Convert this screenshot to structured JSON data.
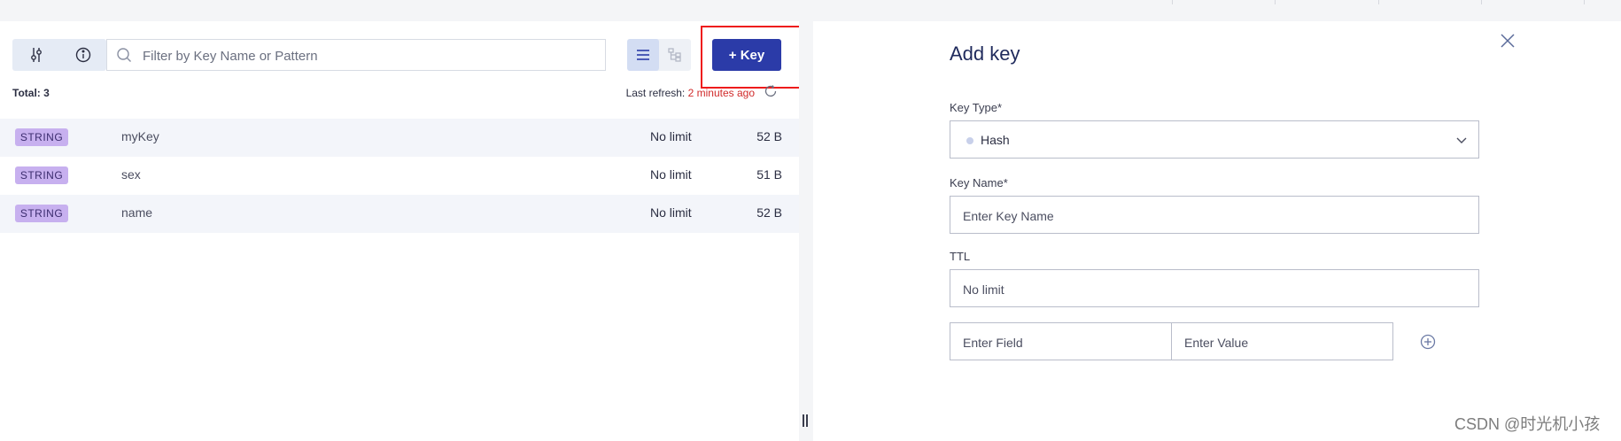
{
  "toolbar": {
    "filter_icon": "sliders-icon",
    "info_icon": "info-icon",
    "search_placeholder": "Filter by Key Name or Pattern",
    "list_view_icon": "list-view-icon",
    "tree_view_icon": "tree-view-icon",
    "add_key_label": "+ Key"
  },
  "status": {
    "total": "Total: 3",
    "last_refresh_label": "Last refresh:",
    "last_refresh_value": "2 minutes ago"
  },
  "keys": [
    {
      "type": "STRING",
      "name": "myKey",
      "ttl": "No limit",
      "size": "52 B"
    },
    {
      "type": "STRING",
      "name": "sex",
      "ttl": "No limit",
      "size": "51 B"
    },
    {
      "type": "STRING",
      "name": "name",
      "ttl": "No limit",
      "size": "52 B"
    }
  ],
  "add_key_form": {
    "title": "Add key",
    "key_type_label": "Key Type*",
    "key_type_value": "Hash",
    "key_name_label": "Key Name*",
    "key_name_placeholder": "Enter Key Name",
    "ttl_label": "TTL",
    "ttl_placeholder": "No limit",
    "field_placeholder": "Enter Field",
    "value_placeholder": "Enter Value"
  },
  "watermark": "CSDN @时光机小孩",
  "colors": {
    "primary": "#2b3ba8",
    "string_badge": "#c7b0ef",
    "highlight": "#ee1c1c",
    "refresh_time": "#d02a2a"
  }
}
